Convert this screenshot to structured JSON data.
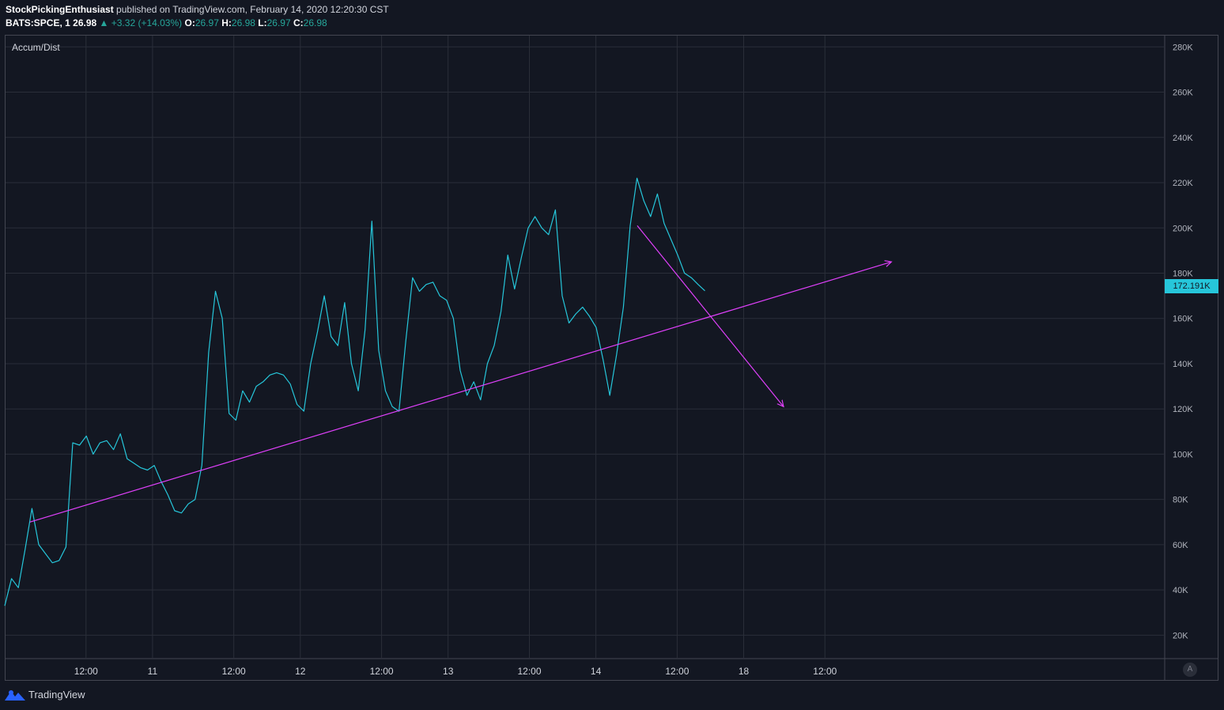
{
  "header": {
    "author": "StockPickingEnthusiast",
    "published": "published on TradingView.com, February 14, 2020 12:20:30 CST",
    "symbol": "BATS:SPCE, 1",
    "last": "26.98",
    "change_arrow": "▲",
    "change": "+3.32 (+14.03%)",
    "o_label": "O:",
    "o_val": "26.97",
    "h_label": "H:",
    "h_val": "26.98",
    "l_label": "L:",
    "l_val": "26.97",
    "c_label": "C:",
    "c_val": "26.98"
  },
  "indicator_label": "Accum/Dist",
  "last_value_tag": "172.191K",
  "auto_scale_label": "A",
  "footer": {
    "brand": "TradingView"
  },
  "colors": {
    "background": "#131722",
    "series": "#26c6da",
    "drawing": "#e040fb",
    "grid": "#2a2e39",
    "up": "#26a69a"
  },
  "chart_data": {
    "type": "line",
    "title": "Accum/Dist",
    "xlabel": "",
    "ylabel": "",
    "ylim": [
      10000,
      285000
    ],
    "grid": true,
    "y_ticks": [
      "20K",
      "40K",
      "60K",
      "80K",
      "100K",
      "120K",
      "140K",
      "160K",
      "180K",
      "200K",
      "220K",
      "240K",
      "260K",
      "280K"
    ],
    "x_ticks": [
      "12:00",
      "11",
      "12:00",
      "12",
      "12:00",
      "13",
      "12:00",
      "14",
      "12:00",
      "18",
      "12:00"
    ],
    "x_tick_index": [
      55,
      100,
      155,
      200,
      255,
      300,
      355,
      400,
      455,
      500,
      555
    ],
    "series": [
      {
        "values": [
          33000,
          45000,
          41000,
          58000,
          76000,
          60000,
          56000,
          52000,
          53000,
          59000,
          105000,
          104000,
          108000,
          100000,
          105000,
          106000,
          102000,
          109000,
          98000,
          96000,
          94000,
          93000,
          95000,
          88000,
          82000,
          75000,
          74000,
          78000,
          80000,
          95000,
          145000,
          172000,
          160000,
          118000,
          115000,
          128000,
          123000,
          130000,
          132000,
          135000,
          136000,
          135000,
          131000,
          122000,
          119000,
          140000,
          154000,
          170000,
          152000,
          148000,
          167000,
          140000,
          128000,
          155000,
          203000,
          146000,
          128000,
          121000,
          119000,
          150000,
          178000,
          172000,
          175000,
          176000,
          170000,
          168000,
          160000,
          137000,
          126000,
          132000,
          124000,
          140000,
          148000,
          163000,
          188000,
          173000,
          187000,
          200000,
          205000,
          200000,
          197000,
          208000,
          170000,
          158000,
          162000,
          165000,
          161000,
          156000,
          142000,
          126000,
          144000,
          165000,
          201000,
          222000,
          212000,
          205000,
          215000,
          202000,
          195000,
          188000,
          180000,
          178000,
          175000,
          172191
        ]
      }
    ],
    "annotations": [
      {
        "type": "trend-arrow",
        "from": [
          17,
          70000
        ],
        "to": [
          600,
          185000
        ]
      },
      {
        "type": "trend-arrow",
        "from": [
          428,
          201000
        ],
        "to": [
          527,
          121000
        ]
      }
    ]
  }
}
